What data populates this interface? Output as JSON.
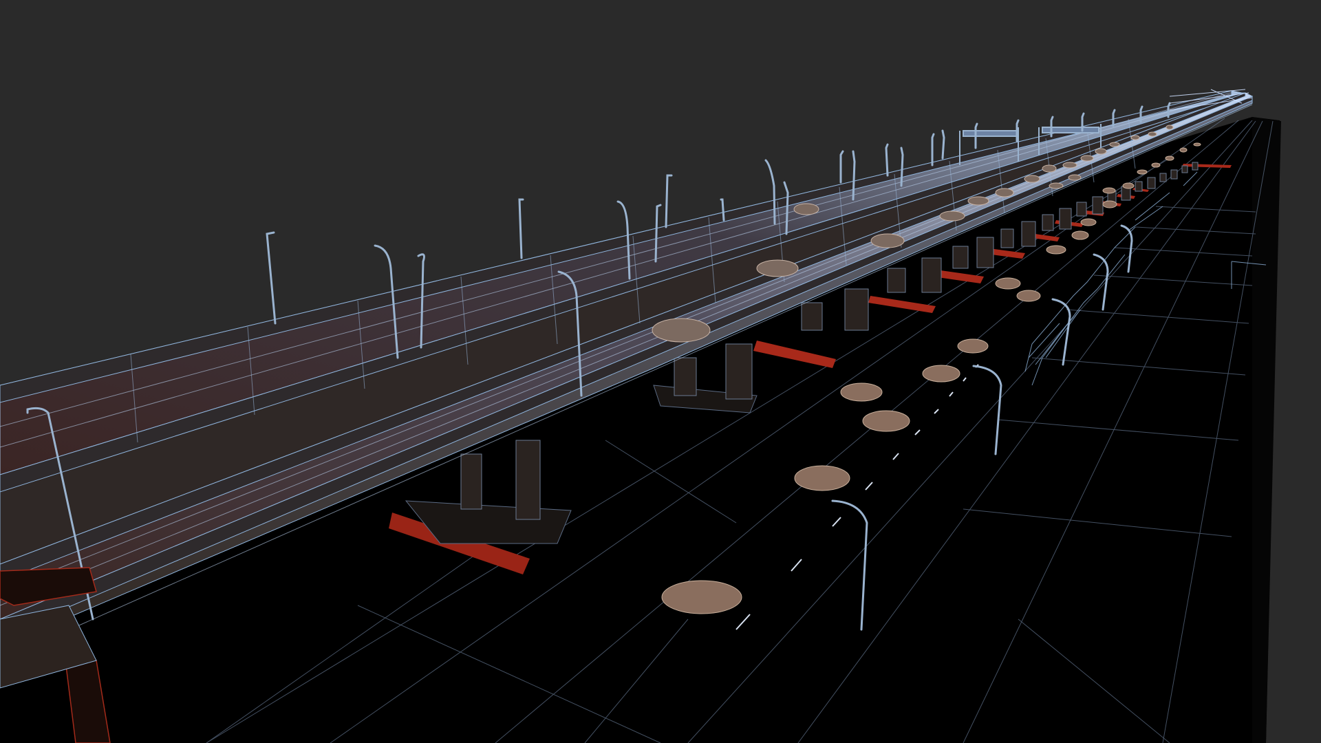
{
  "viewport": {
    "background_color": "#2a2a2a",
    "ground_color": "#000000",
    "wire_color": "#8fb4dc",
    "wire_highlight_color": "#c8dcff",
    "deck_base_color": "#3a2a28",
    "deck_lit_color": "#6d83a4",
    "pier_color": "#2e2622",
    "footing_red_color": "#b02a1a",
    "car_color": "#8a6e5e",
    "lamp_color": "#9ab3cf"
  }
}
